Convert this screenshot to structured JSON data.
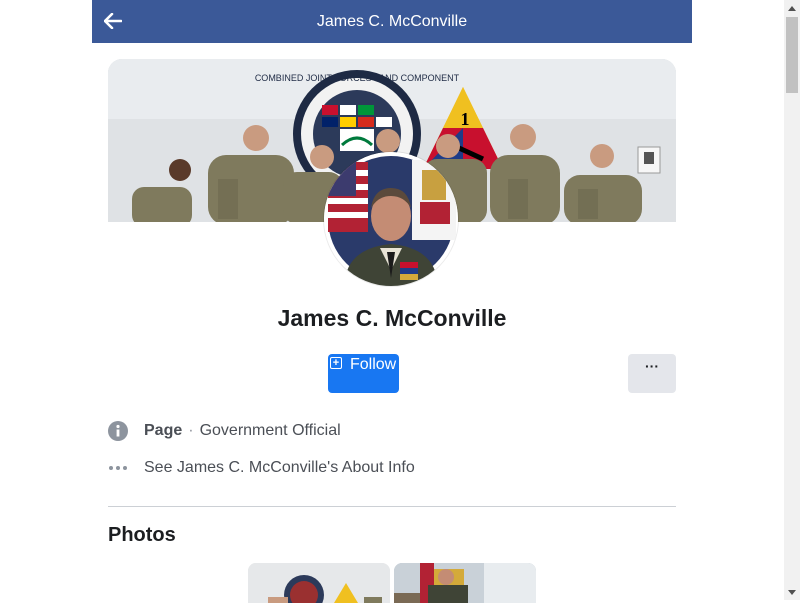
{
  "header": {
    "title": "James C. McConville",
    "back_icon": "arrow-left-icon",
    "background": "#3b5998"
  },
  "cover": {
    "icon": "cover-photo",
    "emblem_text": "COMBINED JOINT FORCES LAND COMPONENT",
    "division_number": "1"
  },
  "profile": {
    "avatar_icon": "profile-photo",
    "name": "James C. McConville"
  },
  "actions": {
    "follow_label": "Follow",
    "follow_icon": "plus-square-icon",
    "follow_color": "#1877f2",
    "more_label": "···"
  },
  "info": {
    "category_strong": "Page",
    "category_sep": "·",
    "category_value": "Government Official",
    "about_link": "See James C. McConville's About Info"
  },
  "photos": {
    "title": "Photos"
  }
}
